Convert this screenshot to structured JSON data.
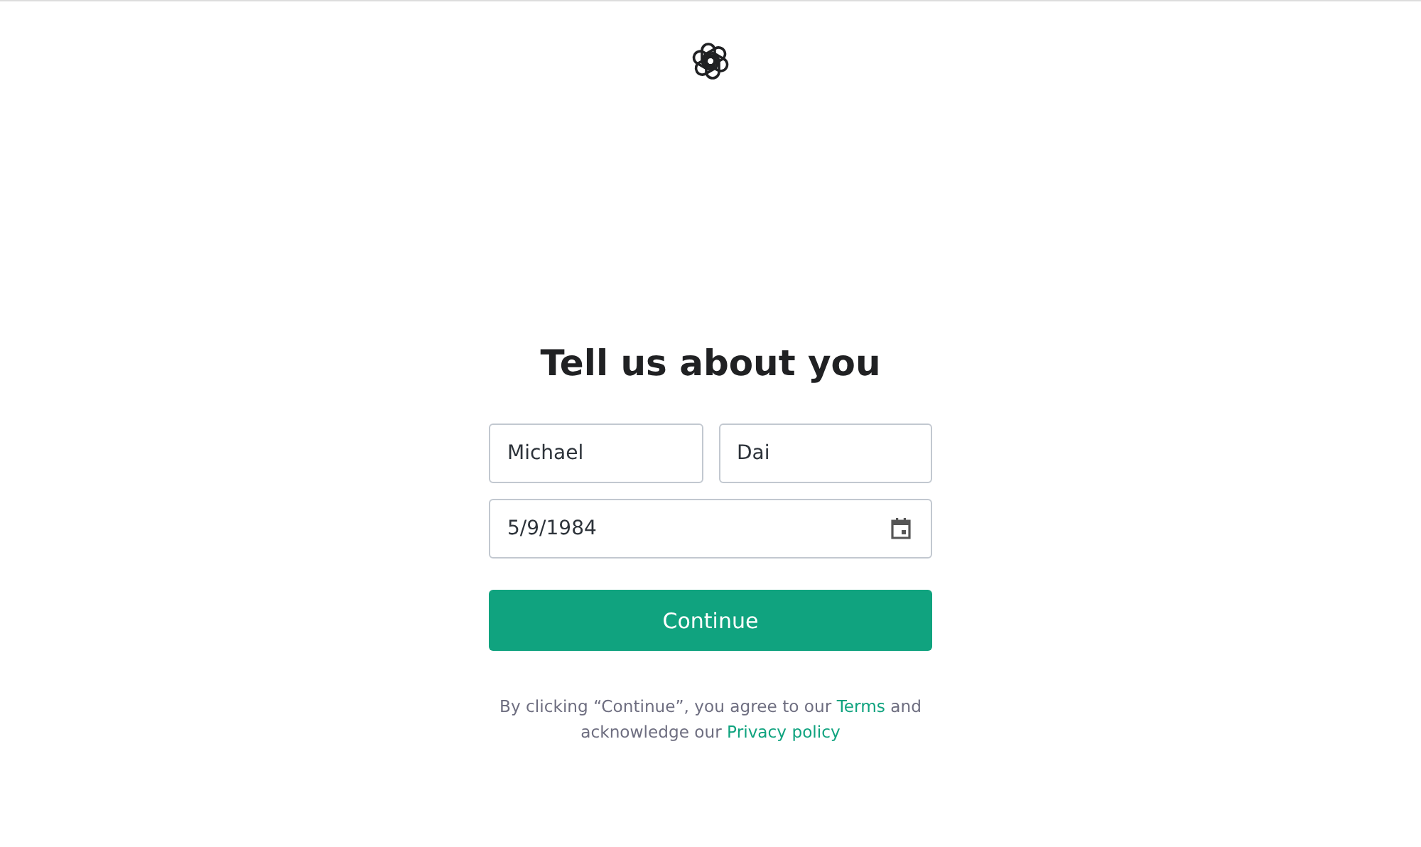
{
  "heading": "Tell us about you",
  "first_name": {
    "value": "Michael"
  },
  "last_name": {
    "value": "Dai"
  },
  "birthday": {
    "value": "5/9/1984"
  },
  "continue_button": {
    "label": "Continue"
  },
  "notice": {
    "text_before": "By clicking “Continue”, you agree to our",
    "terms_link": "Terms",
    "text_middle": "and acknowledge our",
    "privacy_link": "Privacy policy"
  }
}
